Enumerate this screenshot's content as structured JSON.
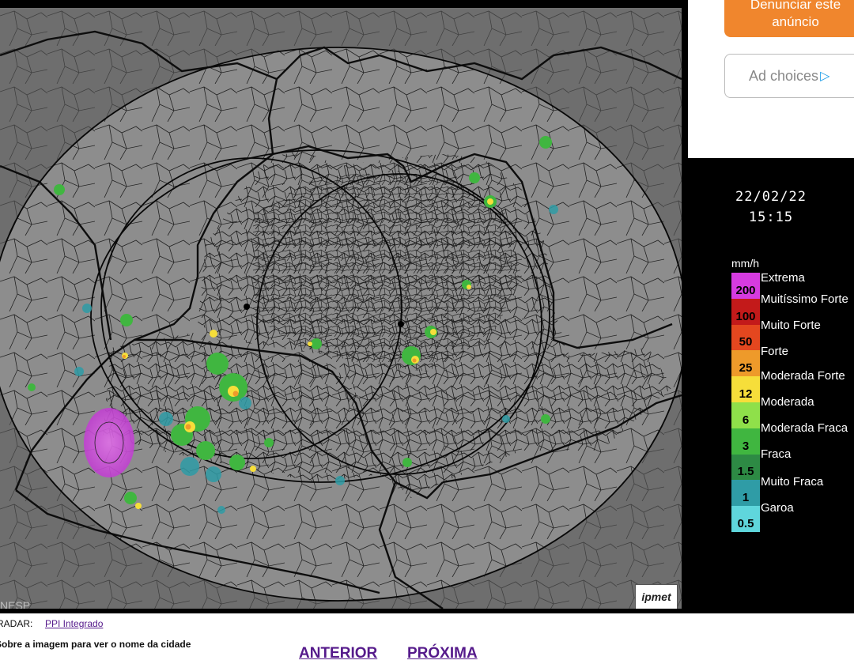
{
  "radar": {
    "datetime_date": "22/02/22",
    "datetime_time": "15:15",
    "unit": "mm/h",
    "watermark": "NESP",
    "logo_text": "ipmet",
    "scale": [
      {
        "value": "200",
        "label": "Extrema",
        "color": "#d63be0"
      },
      {
        "value": "100",
        "label": "Muitíssimo Forte",
        "color": "#c31a1a"
      },
      {
        "value": "50",
        "label": "Muito Forte",
        "color": "#e4471f"
      },
      {
        "value": "25",
        "label": "Forte",
        "color": "#ee9a2a"
      },
      {
        "value": "12",
        "label": "Moderada Forte",
        "color": "#f6de3a"
      },
      {
        "value": "6",
        "label": "Moderada",
        "color": "#8fe04a"
      },
      {
        "value": "3",
        "label": "Moderada Fraca",
        "color": "#40b640"
      },
      {
        "value": "1.5",
        "label": "Fraca",
        "color": "#2d8a44"
      },
      {
        "value": "1",
        "label": "Muito Fraca",
        "color": "#2f9ca6"
      },
      {
        "value": "0.5",
        "label": "Garoa",
        "color": "#5fd6dc"
      }
    ]
  },
  "ads": {
    "report_line1": "Denunciar este",
    "report_line2": "anúncio",
    "adchoices": "Ad choices"
  },
  "footer": {
    "radar_label": "RADAR:",
    "radar_link": "PPI Integrado",
    "hint": "Sobre a imagem para ver o nome da cidade",
    "prev": "ANTERIOR",
    "next": "PRÓXIMA"
  },
  "colors": {
    "map_bg": "#8a8a8a",
    "border": "#111111",
    "ad_orange": "#f0862d",
    "link": "#551a8b"
  }
}
